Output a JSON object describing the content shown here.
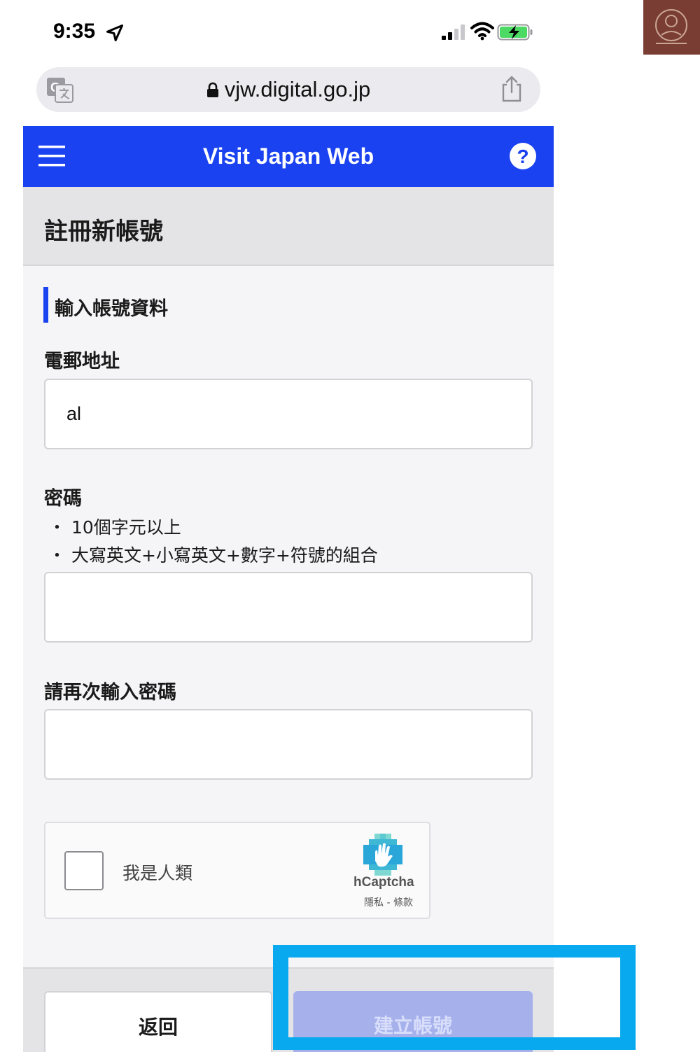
{
  "status_bar": {
    "time": "9:35"
  },
  "browser": {
    "url": "vjw.digital.go.jp"
  },
  "header": {
    "title": "Visit Japan Web"
  },
  "page": {
    "title": "註冊新帳號",
    "section_title": "輸入帳號資料"
  },
  "form": {
    "email_label": "電郵地址",
    "email_value": "al",
    "password_label": "密碼",
    "password_hints": [
      "・ 10個字元以上",
      "・ 大寫英文+小寫英文+數字+符號的組合"
    ],
    "password_value": "",
    "confirm_label": "請再次輸入密碼",
    "confirm_value": ""
  },
  "captcha": {
    "label": "我是人類",
    "brand": "hCaptcha",
    "links": "隱私 - 條款"
  },
  "footer": {
    "back_label": "返回",
    "create_label": "建立帳號"
  },
  "colors": {
    "header_blue": "#1b42f0",
    "highlight": "#09a9ef",
    "disabled_button": "#a6b1ec"
  },
  "icons": [
    "location-arrow-icon",
    "signal-icon",
    "wifi-icon",
    "battery-charging-icon",
    "translate-icon",
    "lock-icon",
    "share-icon",
    "menu-icon",
    "help-icon",
    "hcaptcha-logo-icon"
  ]
}
